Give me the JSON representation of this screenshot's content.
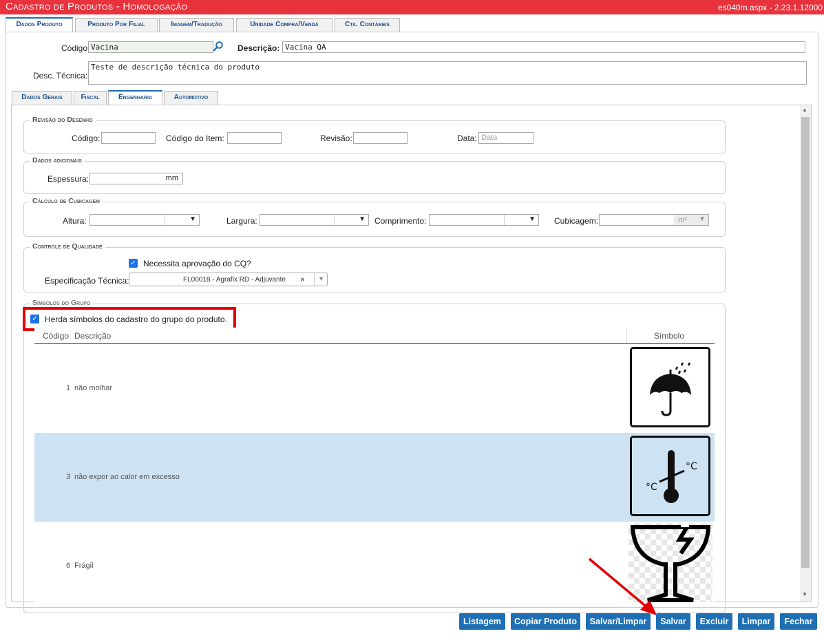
{
  "title": "Cadastro de Produtos  - Homologação",
  "version": "es040m.aspx - 2.23.1.12000",
  "main_tabs": [
    "Dados Produto",
    "Produto Por Filial",
    "Imagem/Tradução",
    "Unidade Compra/Venda",
    "Cta. Contábeis"
  ],
  "header_form": {
    "codigo_label": "Código",
    "codigo_value": "Vacina",
    "descricao_label": "Descrição:",
    "descricao_value": "Vacina QA",
    "desc_tecnica_label": "Desc. Técnica:",
    "desc_tecnica_value": "Teste de descrição técnica do produto"
  },
  "sub_tabs": [
    "Dados Gerais",
    "Fiscal",
    "Engenharia",
    "Automotivo"
  ],
  "revisao": {
    "legend": "Revisão do Desenho",
    "codigo_label": "Código:",
    "codigo_item_label": "Código do Item:",
    "revisao_label": "Revisão:",
    "data_label": "Data:",
    "data_placeholder": "Data"
  },
  "adicionais": {
    "legend": "Dados adicionais",
    "espessura_label": "Espessura:",
    "espessura_unit": "mm"
  },
  "cubicagem": {
    "legend": "Cálculo de Cubicagem",
    "altura_label": "Altura:",
    "largura_label": "Largura:",
    "comprimento_label": "Comprimento:",
    "cubicagem_label": "Cubicagem:",
    "cubicagem_unit": "m³"
  },
  "qualidade": {
    "legend": "Controle de Qualidade",
    "cq_label": "Necessita aprovação do CQ?",
    "cq_checked": true,
    "espec_label": "Especificação Técnica:",
    "espec_value": "FL00018 - Agrafix RD - Adjuvante"
  },
  "simbolos": {
    "legend": "Símbolos do Grupo",
    "herda_label": "Herda símbolos do cadastro do grupo do produto.",
    "herda_checked": true,
    "columns": [
      "Código",
      "Descrição",
      "Símbolo"
    ],
    "rows": [
      {
        "codigo": "1",
        "descricao": "não molhar",
        "icon": "keep-dry-umbrella-icon"
      },
      {
        "codigo": "3",
        "descricao": "não expor ao calor em excesso",
        "icon": "thermometer-icon"
      },
      {
        "codigo": "6",
        "descricao": "Frágil",
        "icon": "fragile-glass-icon"
      }
    ]
  },
  "buttons": [
    "Listagem",
    "Copiar Produto",
    "Salvar/Limpar",
    "Salvar",
    "Excluir",
    "Limpar",
    "Fechar"
  ],
  "colors": {
    "titlebar": "#e8323c",
    "button": "#1e6fb3",
    "selected_row": "#cde3f3",
    "highlight_box": "#e00000",
    "arrow": "#e00000"
  }
}
